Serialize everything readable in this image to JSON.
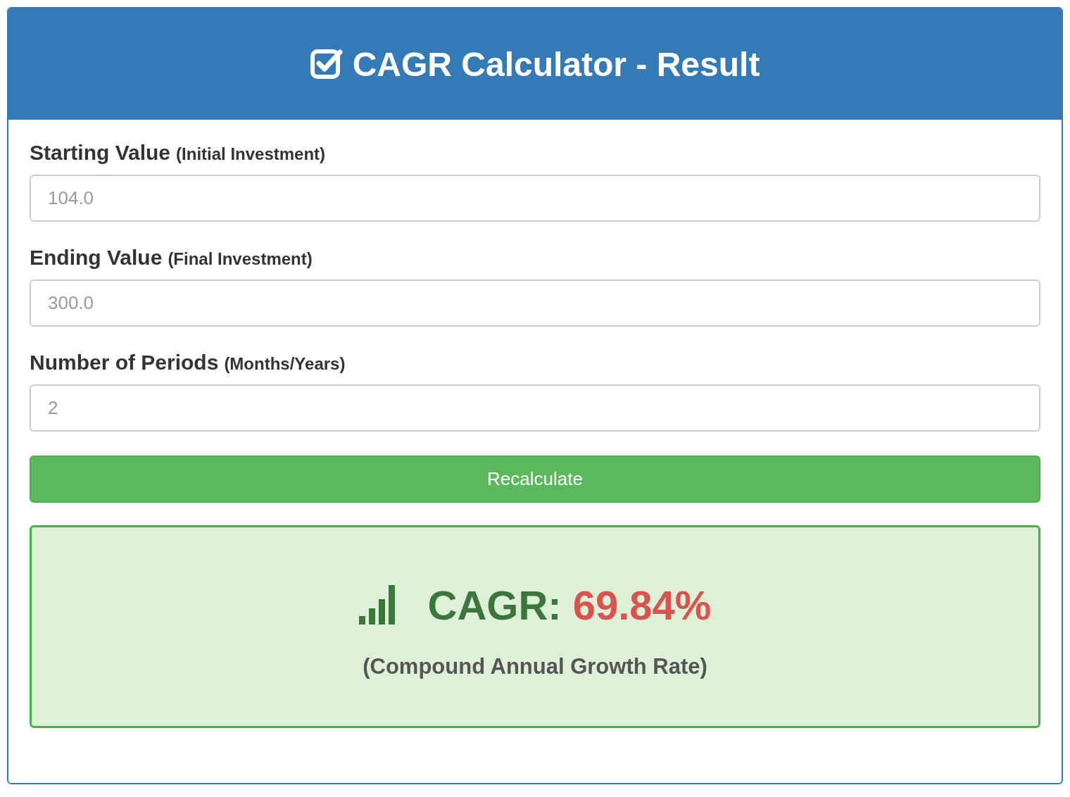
{
  "header": {
    "title": "CAGR Calculator - Result"
  },
  "fields": [
    {
      "label": "Starting Value",
      "hint": "(Initial Investment)",
      "placeholder": "104.0"
    },
    {
      "label": "Ending Value",
      "hint": "(Final Investment)",
      "placeholder": "300.0"
    },
    {
      "label": "Number of Periods",
      "hint": "(Months/Years)",
      "placeholder": "2"
    }
  ],
  "button": {
    "label": "Recalculate"
  },
  "result": {
    "label": "CAGR:",
    "value": "69.84%",
    "caption": "(Compound Annual Growth Rate)"
  }
}
